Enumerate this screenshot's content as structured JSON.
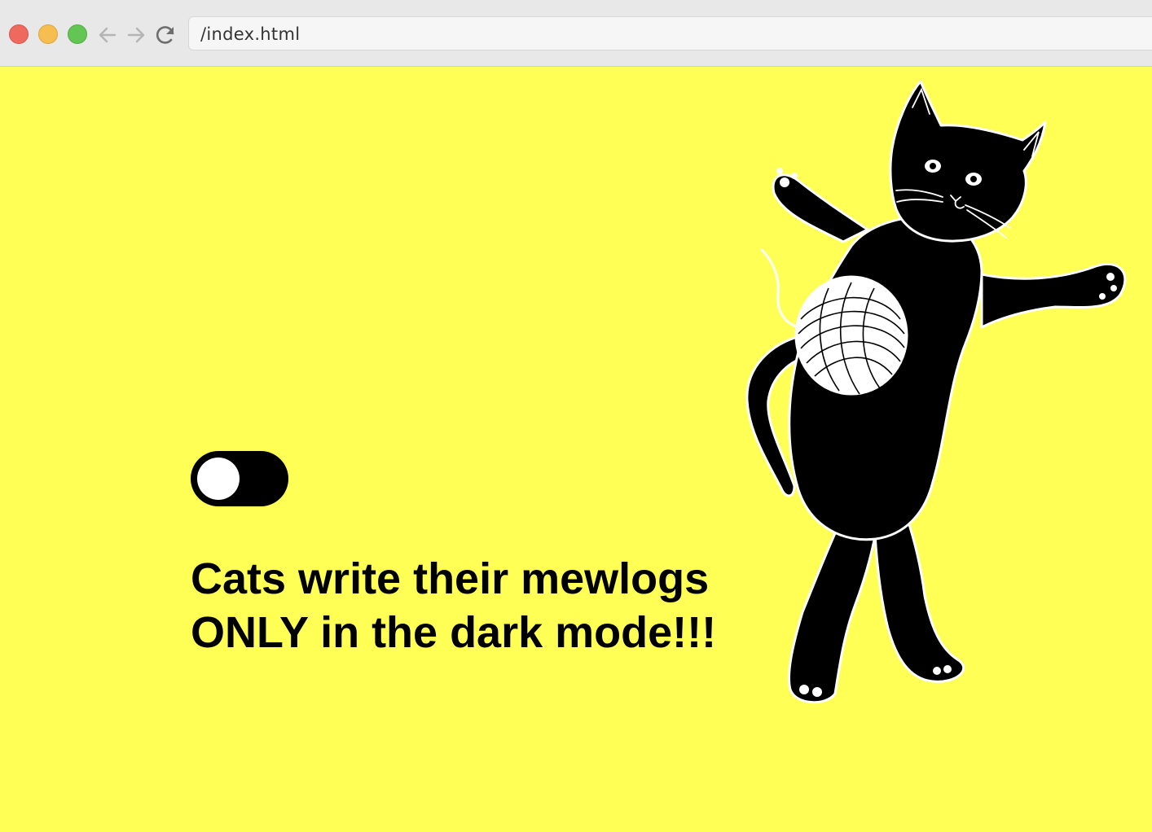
{
  "browser": {
    "url": "/index.html",
    "buttons": {
      "close": "close-window",
      "minimize": "minimize-window",
      "zoom": "zoom-window",
      "back": "arrow-left-icon",
      "forward": "arrow-right-icon",
      "reload": "reload-icon"
    },
    "colors": {
      "close": "#ee6a5e",
      "minimize": "#f5be4f",
      "zoom": "#62c554"
    }
  },
  "page": {
    "background": "#ffff55",
    "toggle": {
      "state": "off",
      "track_color": "#000000",
      "knob_color": "#ffffff"
    },
    "headline": {
      "line1": "Cats write their mewlogs",
      "line2": "ONLY in the dark mode!!!"
    },
    "illustration": {
      "icon": "black-cat-with-yarn-ball"
    }
  }
}
